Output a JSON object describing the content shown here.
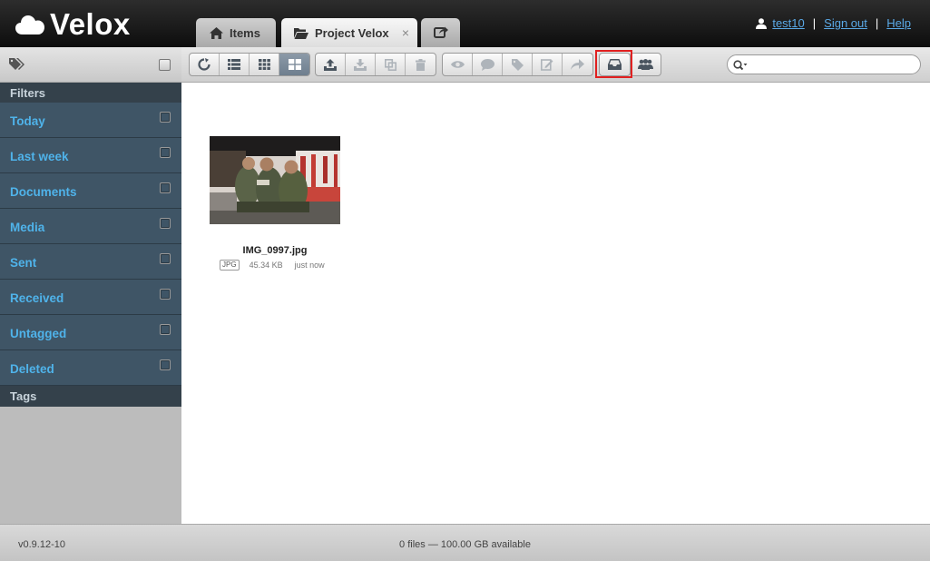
{
  "app": {
    "name": "Velox"
  },
  "tabs": [
    {
      "label": "Items",
      "icon": "home-icon"
    },
    {
      "label": "Project Velox",
      "icon": "folder-open-icon",
      "close": "×"
    },
    {
      "label": "",
      "icon": "share-icon"
    }
  ],
  "user": {
    "name": "test10",
    "sign_out": "Sign out",
    "help": "Help",
    "separator": "|"
  },
  "sidebar": {
    "filters_heading": "Filters",
    "filters": [
      {
        "label": "Today"
      },
      {
        "label": "Last week"
      },
      {
        "label": "Documents"
      },
      {
        "label": "Media"
      },
      {
        "label": "Sent"
      },
      {
        "label": "Received"
      },
      {
        "label": "Untagged"
      },
      {
        "label": "Deleted"
      }
    ],
    "tags_heading": "Tags"
  },
  "toolbar": {
    "view_buttons": [
      "refresh-icon",
      "list-view-icon",
      "grid-view-icon",
      "thumbnail-view-icon"
    ],
    "active_view": "thumbnail-view-icon",
    "file_buttons": [
      "upload-icon",
      "download-icon",
      "copy-icon",
      "trash-icon"
    ],
    "action_buttons": [
      "preview-icon",
      "comment-icon",
      "tag-icon",
      "edit-icon",
      "forward-icon"
    ],
    "inbox_button": "inbox-icon",
    "people_button": "people-icon",
    "search": {
      "placeholder": ""
    }
  },
  "files": [
    {
      "name": "IMG_0997.jpg",
      "type": "JPG",
      "size": "45.34 KB",
      "modified": "just now"
    }
  ],
  "footer": {
    "version": "v0.9.12-10",
    "storage": "0 files — 100.00 GB available"
  },
  "colors": {
    "header_bg": "#1a1a1a",
    "filter_bg": "#3f5566",
    "filter_text": "#4fb3ea",
    "link": "#5aa9e6",
    "highlight": "#e02020"
  }
}
